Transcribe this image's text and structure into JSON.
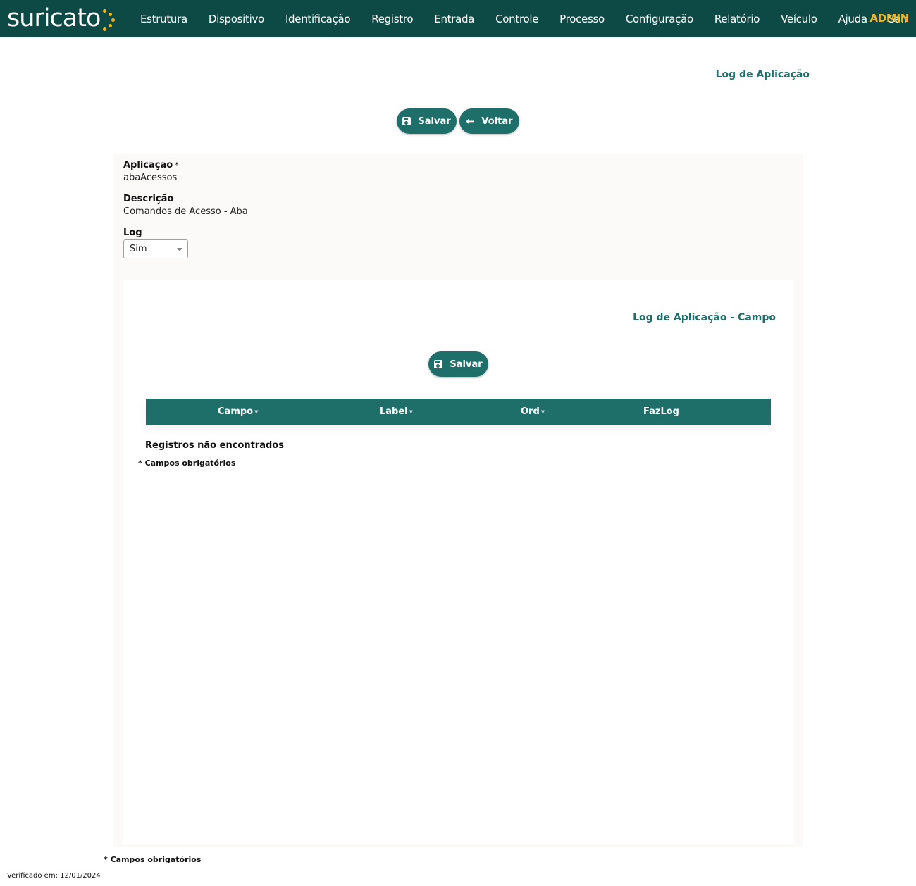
{
  "header": {
    "logo_text": "suricato",
    "nav": [
      "Estrutura",
      "Dispositivo",
      "Identificação",
      "Registro",
      "Entrada",
      "Controle",
      "Processo",
      "Configuração",
      "Relatório",
      "Veículo",
      "Ajuda",
      "Sair"
    ],
    "user": "ADMIN",
    "colors": {
      "bar": "#0e4a45",
      "accent": "#f2b61c"
    }
  },
  "page": {
    "title": "Log de Aplicação",
    "save_label": "Salvar",
    "back_label": "Voltar"
  },
  "form": {
    "app_label": "Aplicação",
    "required_mark": "*",
    "app_value": "abaAcessos",
    "desc_label": "Descrição",
    "desc_value": "Comandos de Acesso - Aba",
    "log_label": "Log",
    "log_value": "Sim"
  },
  "detail": {
    "title": "Log de Aplicação - Campo",
    "save_label": "Salvar",
    "columns": [
      "Campo",
      "Label",
      "Ord",
      "FazLog"
    ],
    "empty_text": "Registros não encontrados",
    "required_note": "* Campos obrigatórios"
  },
  "footer": {
    "required_note": "* Campos obrigatórios",
    "verified": "Verificado em: 12/01/2024"
  },
  "icons": {
    "save": "floppy-disk-icon",
    "back": "arrow-left-icon",
    "sort": "sort-icon",
    "dropdown": "caret-down-icon"
  }
}
